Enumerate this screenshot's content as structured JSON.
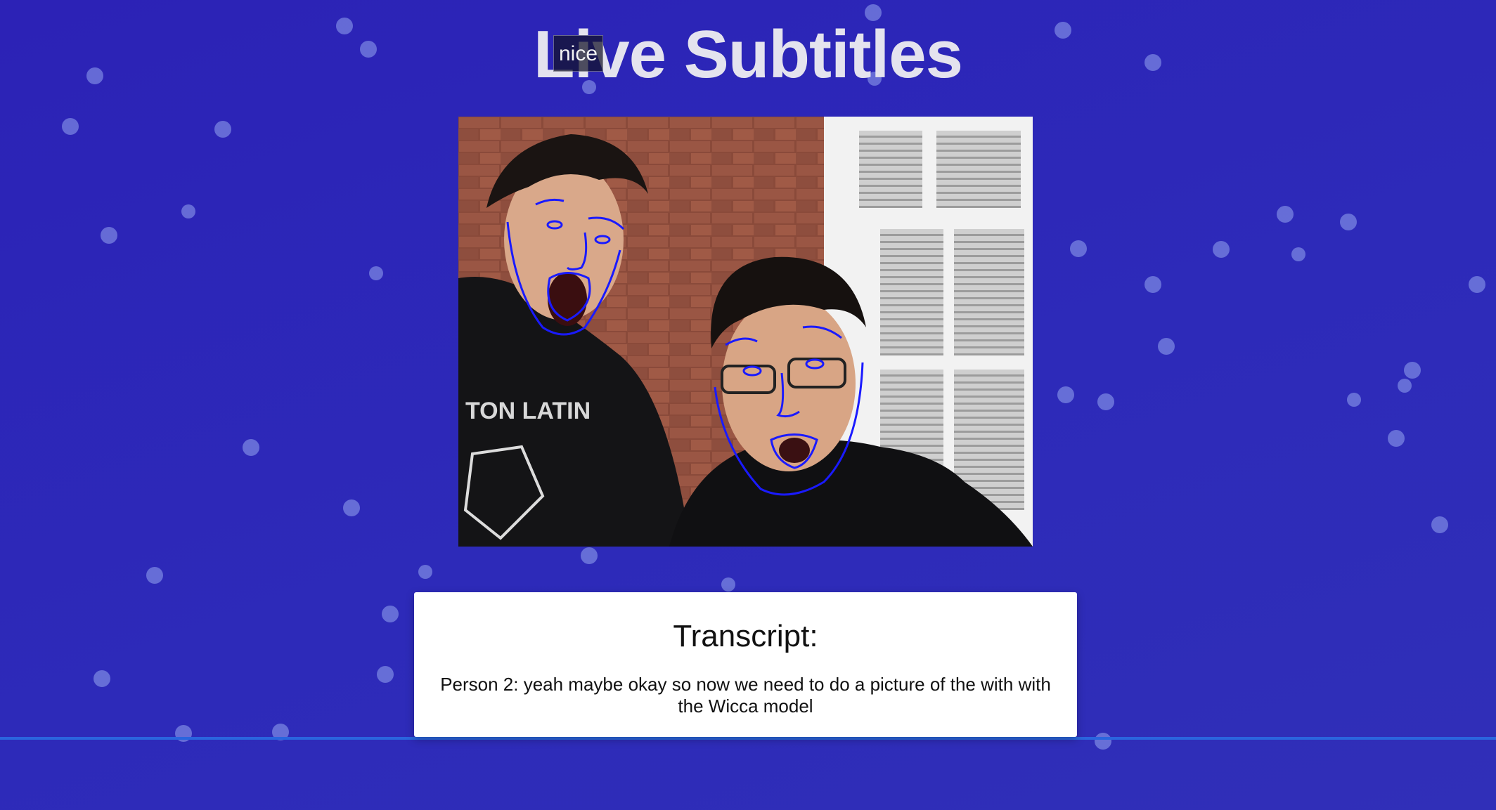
{
  "page": {
    "title": "Live Subtitles",
    "background_color": "#2c27b7",
    "accent_line_color": "#2a65de"
  },
  "live_subtitle": {
    "text": "nice"
  },
  "video": {
    "icon": "webcam-feed",
    "overlay": "face-landmark-outlines",
    "overlay_color": "#1a1aff"
  },
  "transcript": {
    "heading": "Transcript:",
    "text": "Person 2: yeah maybe okay so now we need to do a picture of the with with the Wicca model"
  }
}
